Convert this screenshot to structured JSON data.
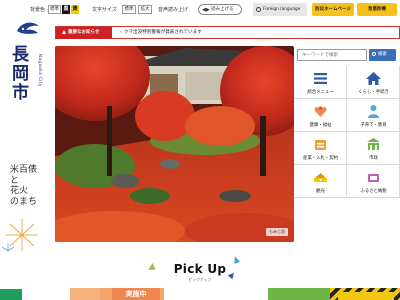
{
  "topbar": {
    "text_size_label": "背景色",
    "bg_standard": "標準",
    "bg_black": "黒",
    "bg_yellow": "黄",
    "font_size_label": "文字サイズ",
    "font_standard": "標準",
    "font_large": "拡大",
    "speech_label": "音声読み上げ",
    "speech_button": "読み上げる",
    "foreign_language": "Foreign language",
    "recommended_home": "防災ホームページ",
    "emergency": "急患診療"
  },
  "logo": {
    "name": "長岡市",
    "english": "Nagaoka City",
    "tagline_lines": [
      "米百俵",
      "と",
      "花火",
      "のまち"
    ]
  },
  "notice": {
    "tag": "重要なお知らせ",
    "text": "クマ出没特別警報が発表されています"
  },
  "hero": {
    "credit": "もみじ園"
  },
  "search": {
    "placeholder": "キーワードで検索",
    "button": "検索"
  },
  "menu": {
    "items": [
      {
        "label": "総合メニュー",
        "icon": "menu-icon"
      },
      {
        "label": "くらし・手続き",
        "icon": "house-icon"
      },
      {
        "label": "健康・福祉",
        "icon": "health-icon"
      },
      {
        "label": "子育て・教育",
        "icon": "child-icon"
      },
      {
        "label": "産業・入札・契約",
        "icon": "industry-icon"
      },
      {
        "label": "市政",
        "icon": "city-hall-icon"
      },
      {
        "label": "観光",
        "icon": "tourism-icon"
      },
      {
        "label": "ふるさと納税",
        "icon": "hometown-tax-icon"
      }
    ]
  },
  "pickup": {
    "title": "Pick Up",
    "subtitle": "ピックアップ"
  },
  "bottom": {
    "badge": "実施中"
  },
  "colors": {
    "accent_blue": "#3b6fb5",
    "menu_blue": "#2d5aa8",
    "notice_red": "#cc2222",
    "top_yellow": "#f6c21a"
  }
}
